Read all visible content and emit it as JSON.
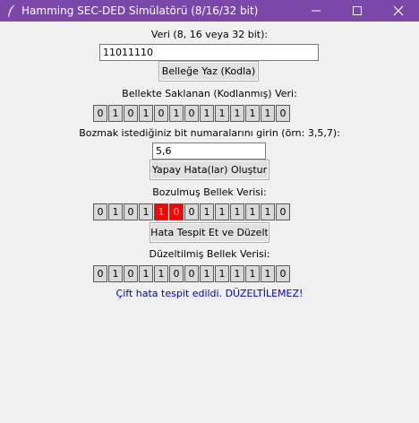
{
  "window": {
    "title": "Hamming SEC-DED Simülatörü (8/16/32 bit)"
  },
  "data_label": "Veri (8, 16 veya 32 bit):",
  "data_input_value": "11011110",
  "encode_button": "Belleğe Yaz (Kodla)",
  "stored_label": "Bellekte Saklanan (Kodlanmış) Veri:",
  "stored_bits": [
    "0",
    "1",
    "0",
    "1",
    "0",
    "1",
    "0",
    "1",
    "1",
    "1",
    "1",
    "1",
    "0"
  ],
  "flip_label": "Bozmak istediğiniz bit numaralarını girin (örn: 3,5,7):",
  "flip_input_value": "5,6",
  "inject_button": "Yapay Hata(lar) Oluştur",
  "corrupted_label": "Bozulmuş Bellek Verisi:",
  "corrupted_bits": [
    "0",
    "1",
    "0",
    "1",
    "1",
    "0",
    "0",
    "1",
    "1",
    "1",
    "1",
    "1",
    "0"
  ],
  "error_positions": [
    5,
    6
  ],
  "error_color": "#ff0000",
  "detect_button": "Hata Tespit Et ve Düzelt",
  "corrected_label": "Düzeltilmiş Bellek Verisi:",
  "corrected_bits": [
    "0",
    "1",
    "0",
    "1",
    "1",
    "0",
    "0",
    "1",
    "1",
    "1",
    "1",
    "1",
    "0"
  ],
  "status_message": "Çift hata tespit edildi. DÜZELTİLEMEZ!",
  "status_color": "#0000cc",
  "accent_color": "#7a48a8"
}
